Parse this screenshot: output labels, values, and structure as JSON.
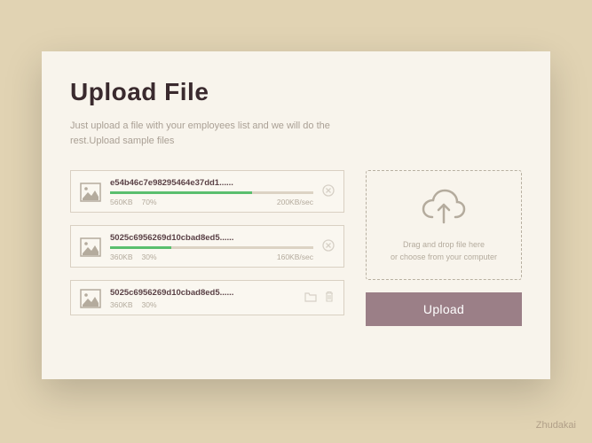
{
  "title": "Upload File",
  "subtitle": "Just upload a file with your employees list and we will do the rest.Upload sample files",
  "files": [
    {
      "name": "e54b46c7e98295464e37dd1......",
      "size": "560KB",
      "percent_label": "70%",
      "percent": 70,
      "speed": "200KB/sec",
      "uploading": true
    },
    {
      "name": "5025c6956269d10cbad8ed5......",
      "size": "360KB",
      "percent_label": "30%",
      "percent": 30,
      "speed": "160KB/sec",
      "uploading": true
    },
    {
      "name": "5025c6956269d10cbad8ed5......",
      "size": "360KB",
      "percent_label": "30%",
      "percent": 30,
      "speed": "",
      "uploading": false
    }
  ],
  "dropzone": {
    "line1": "Drag and drop file here",
    "line2": "or choose from your computer"
  },
  "upload_label": "Upload",
  "credit": "Zhudakai",
  "colors": {
    "accent": "#5abf6e",
    "button": "#9b7f87"
  }
}
